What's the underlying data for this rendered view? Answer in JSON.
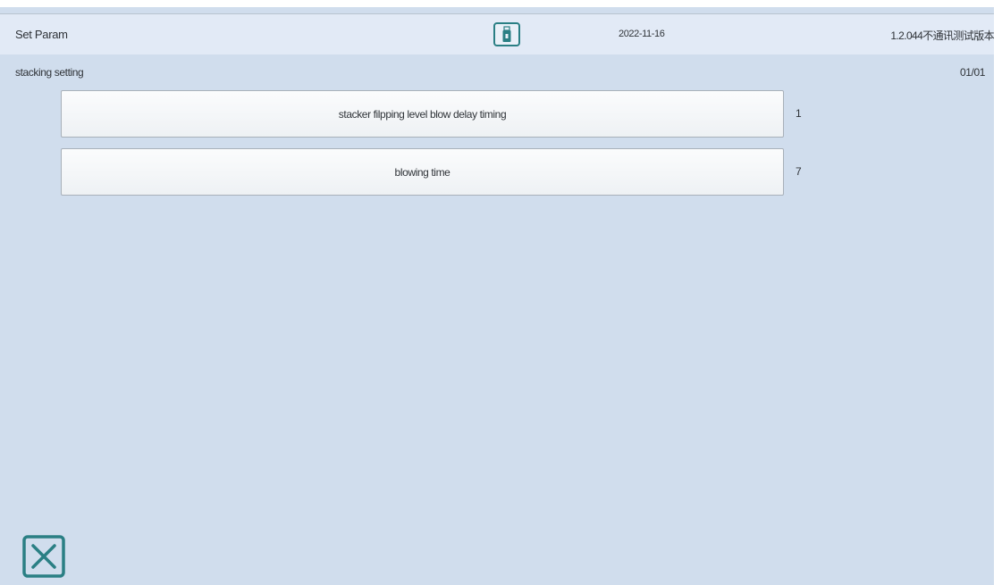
{
  "header": {
    "title": "Set Param",
    "usb_icon": "usb-drive-icon",
    "date": "2022-11-16",
    "version": "1.2.044不通讯测试版本"
  },
  "section": {
    "title": "stacking setting",
    "page": "01/01"
  },
  "params": [
    {
      "label": "stacker filpping level blow delay timing",
      "value": "1"
    },
    {
      "label": "blowing time",
      "value": "7"
    }
  ],
  "footer": {
    "close_icon": "close-box-icon"
  },
  "colors": {
    "background": "#d0dded",
    "header": "#e2eaf6",
    "accent": "#2a7f84",
    "text": "#2f3338"
  }
}
